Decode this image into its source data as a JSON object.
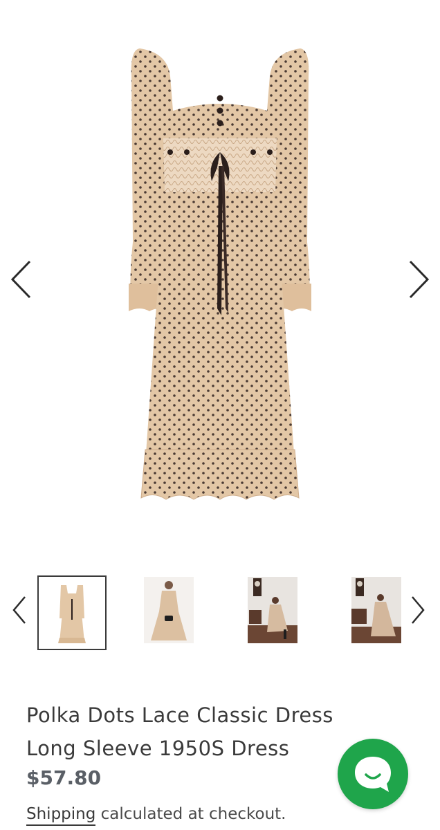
{
  "product": {
    "title_line1": "Polka Dots Lace Classic Dress",
    "title_line2": "Long Sleeve 1950S Dress",
    "price": "$57.80",
    "shipping_link": "Shipping",
    "shipping_text": " calculated at checkout."
  },
  "gallery": {
    "thumbnail_count": 4,
    "active_index": 0
  },
  "colors": {
    "dress": "#e3c7a6",
    "dots": "#4a3a33",
    "ribbon": "#2b1f1c",
    "chat_green": "#1fa54b",
    "price": "#5a5f66"
  },
  "icons": {
    "prev": "chevron-left-icon",
    "next": "chevron-right-icon",
    "chat": "chat-bubble-icon"
  }
}
